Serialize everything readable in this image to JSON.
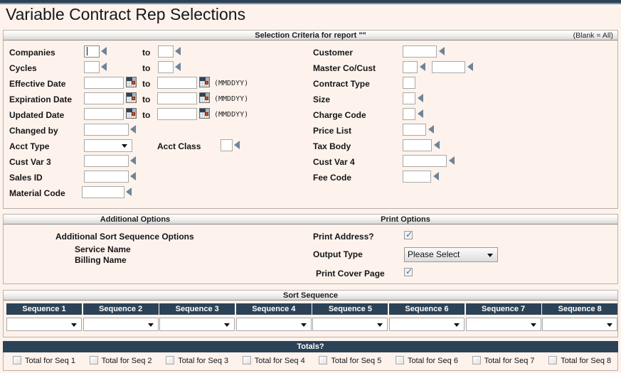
{
  "window": {
    "title": "Variable Contract Rep Selections"
  },
  "selection_criteria": {
    "header": "Selection Criteria for report \"\"",
    "header_right": "(Blank = All)",
    "to_word": "to",
    "date_format": "(MMDDYY)",
    "left_fields": [
      {
        "label": "Companies",
        "type": "range_small",
        "value": "",
        "value2": "",
        "focused": true
      },
      {
        "label": "Cycles",
        "type": "range_small",
        "value": "",
        "value2": "",
        "focused": false
      },
      {
        "label": "Effective  Date",
        "type": "range_date",
        "value": "",
        "value2": ""
      },
      {
        "label": "Expiration Date",
        "type": "range_date",
        "value": "",
        "value2": ""
      },
      {
        "label": "Updated Date",
        "type": "range_date",
        "value": "",
        "value2": ""
      },
      {
        "label": "Changed by",
        "type": "text_lookup",
        "value": ""
      },
      {
        "label": "Acct Type",
        "type": "select",
        "value": ""
      },
      {
        "label": "Cust Var 3",
        "type": "text_lookup",
        "value": ""
      },
      {
        "label": "Sales ID",
        "type": "text_lookup",
        "value": ""
      },
      {
        "label": "Material Code",
        "type": "text_lookup",
        "value": ""
      }
    ],
    "acct_class": {
      "label": "Acct Class",
      "value": ""
    },
    "right_fields": [
      {
        "label": "Customer",
        "type": "text_lookup",
        "value": ""
      },
      {
        "label": "Master Co/Cust",
        "type": "dual_lookup",
        "value": "",
        "value2": ""
      },
      {
        "label": "Contract Type",
        "type": "text_nolookup",
        "value": ""
      },
      {
        "label": "Size",
        "type": "text_lookup",
        "value": ""
      },
      {
        "label": "Charge Code",
        "type": "text_lookup",
        "value": ""
      },
      {
        "label": "Price List",
        "type": "text_lookup",
        "value": ""
      },
      {
        "label": "Tax Body",
        "type": "text_lookup",
        "value": ""
      },
      {
        "label": "Cust Var 4",
        "type": "text_lookup",
        "value": ""
      },
      {
        "label": "Fee Code",
        "type": "text_lookup",
        "value": ""
      }
    ]
  },
  "additional_options": {
    "header": "Additional Options",
    "title": "Additional  Sort Sequence Options",
    "items": [
      "Service Name",
      "Billing Name"
    ]
  },
  "print_options": {
    "header": "Print Options",
    "print_address": {
      "label": "Print Address?",
      "checked": true
    },
    "output_type": {
      "label": "Output Type",
      "value": "Please Select"
    },
    "print_cover_page": {
      "label": "Print Cover Page",
      "checked": true
    }
  },
  "sort_sequence": {
    "header": "Sort Sequence",
    "columns": [
      {
        "label": "Sequence 1",
        "value": ""
      },
      {
        "label": "Sequence 2",
        "value": ""
      },
      {
        "label": "Sequence 3",
        "value": ""
      },
      {
        "label": "Sequence 4",
        "value": ""
      },
      {
        "label": "Sequence 5",
        "value": ""
      },
      {
        "label": "Sequence 6",
        "value": ""
      },
      {
        "label": "Sequence 7",
        "value": ""
      },
      {
        "label": "Sequence 8",
        "value": ""
      }
    ]
  },
  "totals": {
    "header": "Totals?",
    "items": [
      {
        "label": "Total for Seq 1",
        "checked": false
      },
      {
        "label": "Total for Seq 2",
        "checked": false
      },
      {
        "label": "Total for Seq 3",
        "checked": false
      },
      {
        "label": "Total for Seq 4",
        "checked": false
      },
      {
        "label": "Total for Seq 5",
        "checked": false
      },
      {
        "label": "Total for Seq 6",
        "checked": false
      },
      {
        "label": "Total for Seq 7",
        "checked": false
      },
      {
        "label": "Total for Seq 8",
        "checked": false
      }
    ]
  },
  "colors": {
    "dark_navy": "#2c4257",
    "page_bg": "#fdf3ec",
    "lookup_arrow": "#6f8499",
    "check_blue": "#2f6fb5"
  }
}
